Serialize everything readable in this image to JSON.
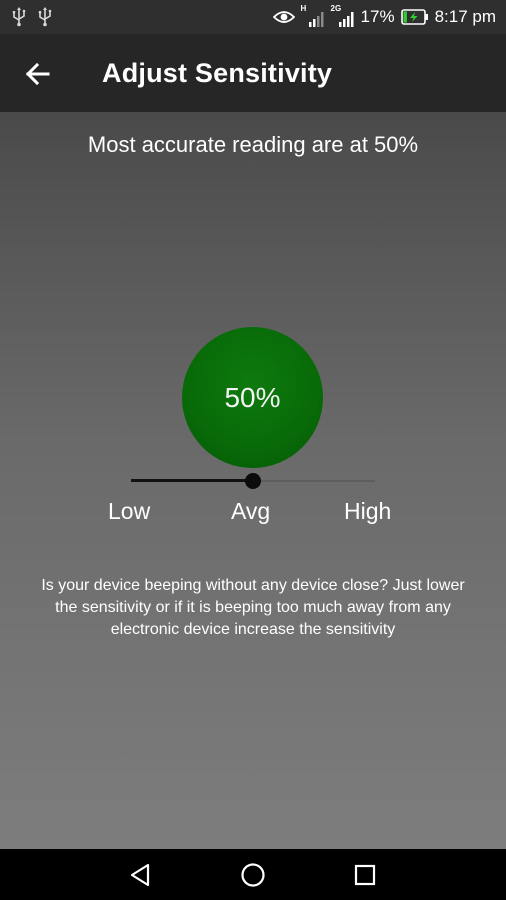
{
  "status_bar": {
    "left_icons": [
      "usb-icon",
      "usb-icon"
    ],
    "network_tags": [
      "H",
      "2G"
    ],
    "battery_percent": "17%",
    "battery_level": 0.17,
    "time": "8:17 pm"
  },
  "app_bar": {
    "title": "Adjust Sensitivity",
    "back_icon": "arrow-left-icon"
  },
  "content": {
    "headline": "Most accurate reading are at 50%",
    "circle_value": "50%",
    "sensitivity": {
      "value": 0.5,
      "labels": {
        "low": "Low",
        "avg": "Avg",
        "high": "High"
      }
    },
    "help_text": "Is your device beeping without any device close? Just lower the sensitivity or if it is beeping too much away from any electronic device increase the sensitivity"
  },
  "nav_bar": {
    "icons": [
      "nav-back-icon",
      "nav-home-icon",
      "nav-recents-icon"
    ]
  },
  "colors": {
    "circle": "#086a08",
    "app_bar": "#262626",
    "status_bar": "#2f2f2f",
    "nav_bar": "#000000",
    "slider_fill": "#111111"
  }
}
